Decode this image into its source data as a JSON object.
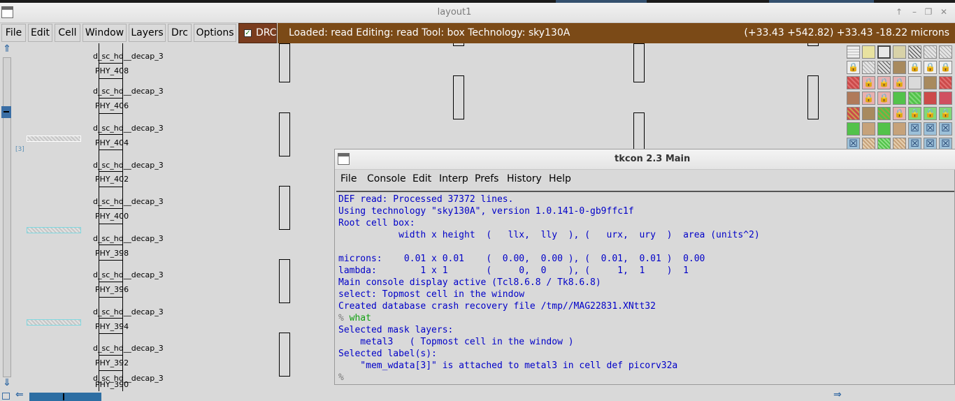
{
  "window": {
    "title": "layout1",
    "controls": [
      "↑",
      "–",
      "❐",
      "✕"
    ]
  },
  "menu": {
    "items": [
      "File",
      "Edit",
      "Cell",
      "Window",
      "Layers",
      "Drc",
      "Options"
    ],
    "drc_toggle": {
      "label": "DRC",
      "checked": true
    },
    "status_left": "Loaded: read Editing: read Tool: box  Technology: sky130A",
    "status_right": "(+33.43 +542.82) +33.43 -18.22 microns"
  },
  "canvas": {
    "labels_decap": [
      "d_sc_hd__decap_3",
      "d_sc_hd__decap_3",
      "d_sc_hd__decap_3",
      "d_sc_hd__decap_3",
      "d_sc_hd__decap_3",
      "d_sc_hd__decap_3",
      "d_sc_hd__decap_3",
      "d_sc_hd__decap_3",
      "d_sc_hd__decap_3",
      "d_sc_hd__decap_3"
    ],
    "labels_phy": [
      "PHY_408",
      "PHY_406",
      "PHY_404",
      "PHY_402",
      "PHY_400",
      "PHY_398",
      "PHY_396",
      "PHY_394",
      "PHY_392",
      "PHY_390"
    ],
    "small_label": "[3]"
  },
  "palette": {
    "colors": {
      "red": "#cc4a4a",
      "brown": "#a88a5e",
      "green": "#52c24a",
      "tan": "#c6a27a",
      "blue": "#3a6ea5"
    }
  },
  "tkcon": {
    "title": "tkcon 2.3 Main",
    "menu": [
      "File",
      "Console",
      "Edit",
      "Interp",
      "Prefs",
      "History",
      "Help"
    ],
    "lines": [
      {
        "text": "DEF read: Processed 37372 lines.",
        "kind": "out"
      },
      {
        "text": "Using technology \"sky130A\", version 1.0.141-0-gb9ffc1f",
        "kind": "out"
      },
      {
        "text": "Root cell box:",
        "kind": "out"
      },
      {
        "text": "           width x height  (   llx,  lly  ), (   urx,  ury  )  area (units^2)",
        "kind": "out"
      },
      {
        "text": "",
        "kind": "out"
      },
      {
        "text": "microns:    0.01 x 0.01    (  0.00,  0.00 ), (  0.01,  0.01 )  0.00",
        "kind": "out"
      },
      {
        "text": "lambda:        1 x 1       (     0,  0    ), (     1,  1    )  1",
        "kind": "out"
      },
      {
        "text": "Main console display active (Tcl8.6.8 / Tk8.6.8)",
        "kind": "out"
      },
      {
        "text": "select: Topmost cell in the window",
        "kind": "out"
      },
      {
        "text": "Created database crash recovery file /tmp//MAG22831.XNtt32",
        "kind": "out"
      },
      {
        "text": "what",
        "kind": "cmd"
      },
      {
        "text": "Selected mask layers:",
        "kind": "out"
      },
      {
        "text": "    metal3   ( Topmost cell in the window )",
        "kind": "out"
      },
      {
        "text": "Selected label(s):",
        "kind": "out"
      },
      {
        "text": "    \"mem_wdata[3]\" is attached to metal3 in cell def picorv32a",
        "kind": "out"
      }
    ],
    "prompt": "%"
  }
}
